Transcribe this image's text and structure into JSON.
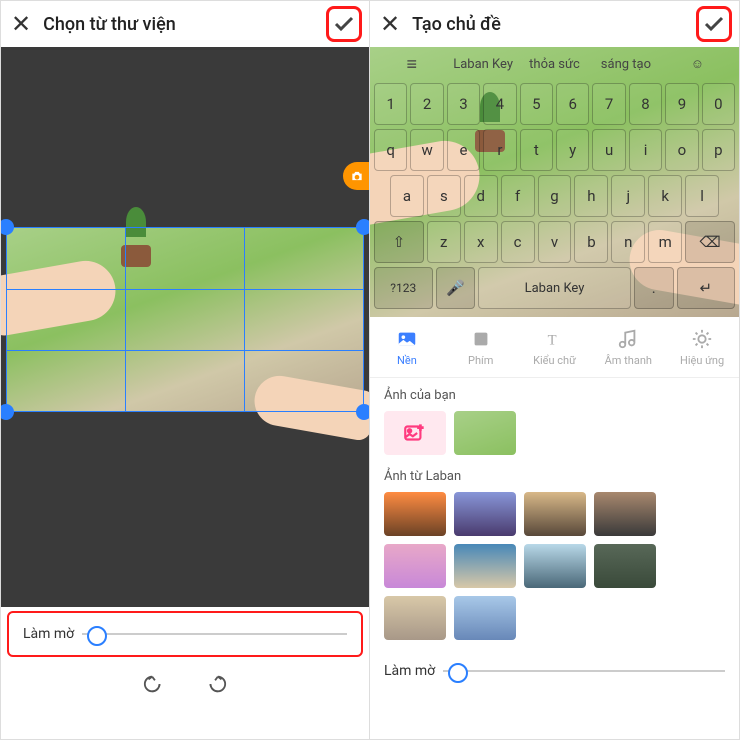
{
  "left": {
    "title": "Chọn từ thư viện",
    "blur_label": "Làm mờ"
  },
  "right": {
    "title": "Tạo chủ đề",
    "sugg": {
      "w1": "Laban Key",
      "w2": "thỏa sức",
      "w3": "sáng tạo"
    },
    "kb": {
      "r1": [
        "1",
        "2",
        "3",
        "4",
        "5",
        "6",
        "7",
        "8",
        "9",
        "0"
      ],
      "r2": [
        "q",
        "w",
        "e",
        "r",
        "t",
        "y",
        "u",
        "i",
        "o",
        "p"
      ],
      "r3": [
        "a",
        "s",
        "d",
        "f",
        "g",
        "h",
        "j",
        "k",
        "l"
      ],
      "r4": [
        "z",
        "x",
        "c",
        "v",
        "b",
        "n",
        "m"
      ],
      "sym": "?123",
      "space": "Laban Key"
    },
    "tabs": [
      {
        "l": "Nền"
      },
      {
        "l": "Phím"
      },
      {
        "l": "Kiểu chữ"
      },
      {
        "l": "Âm thanh"
      },
      {
        "l": "Hiệu ứng"
      }
    ],
    "sec_user": "Ảnh của bạn",
    "sec_laban": "Ảnh từ Laban",
    "blur_label": "Làm mờ"
  }
}
